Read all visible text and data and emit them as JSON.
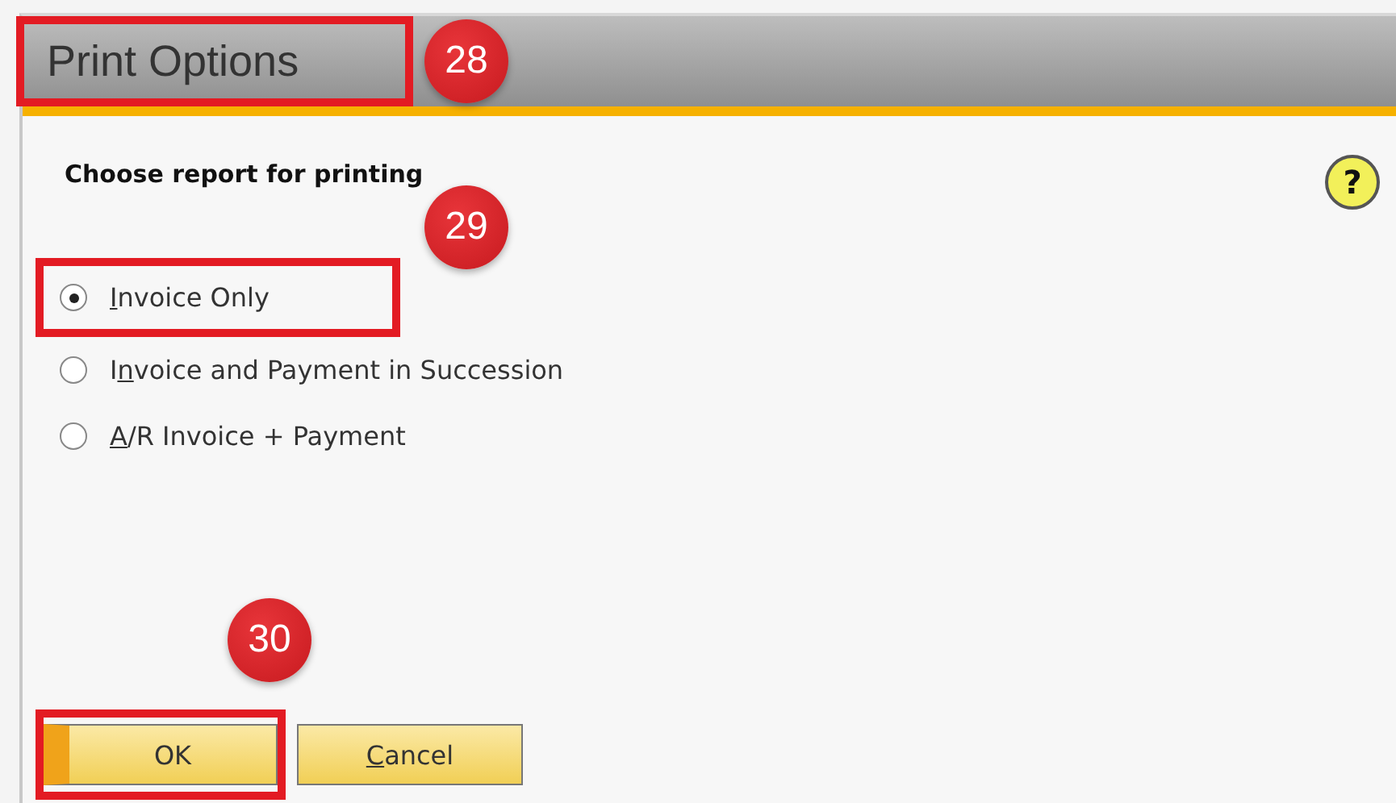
{
  "window": {
    "title": "Print Options",
    "callout": "28"
  },
  "heading": "Choose report for printing",
  "help": {
    "symbol": "?"
  },
  "options": [
    {
      "label_parts": [
        {
          "text": "I",
          "underlined": true
        },
        {
          "text": "nvoice Only",
          "underlined": false
        }
      ],
      "selected": true,
      "callout": "29"
    },
    {
      "label_parts": [
        {
          "text": "I",
          "underlined": false
        },
        {
          "text": "n",
          "underlined": true
        },
        {
          "text": "voice and Payment in Succession",
          "underlined": false
        }
      ],
      "selected": false
    },
    {
      "label_parts": [
        {
          "text": "A",
          "underlined": true
        },
        {
          "text": "/R Invoice + Payment",
          "underlined": false
        }
      ],
      "selected": false
    }
  ],
  "buttons": [
    {
      "label_parts": [
        {
          "text": "OK",
          "underlined": false
        }
      ],
      "default": true,
      "callout": "30"
    },
    {
      "label_parts": [
        {
          "text": "C",
          "underlined": true
        },
        {
          "text": "ancel",
          "underlined": false
        }
      ],
      "default": false
    }
  ]
}
